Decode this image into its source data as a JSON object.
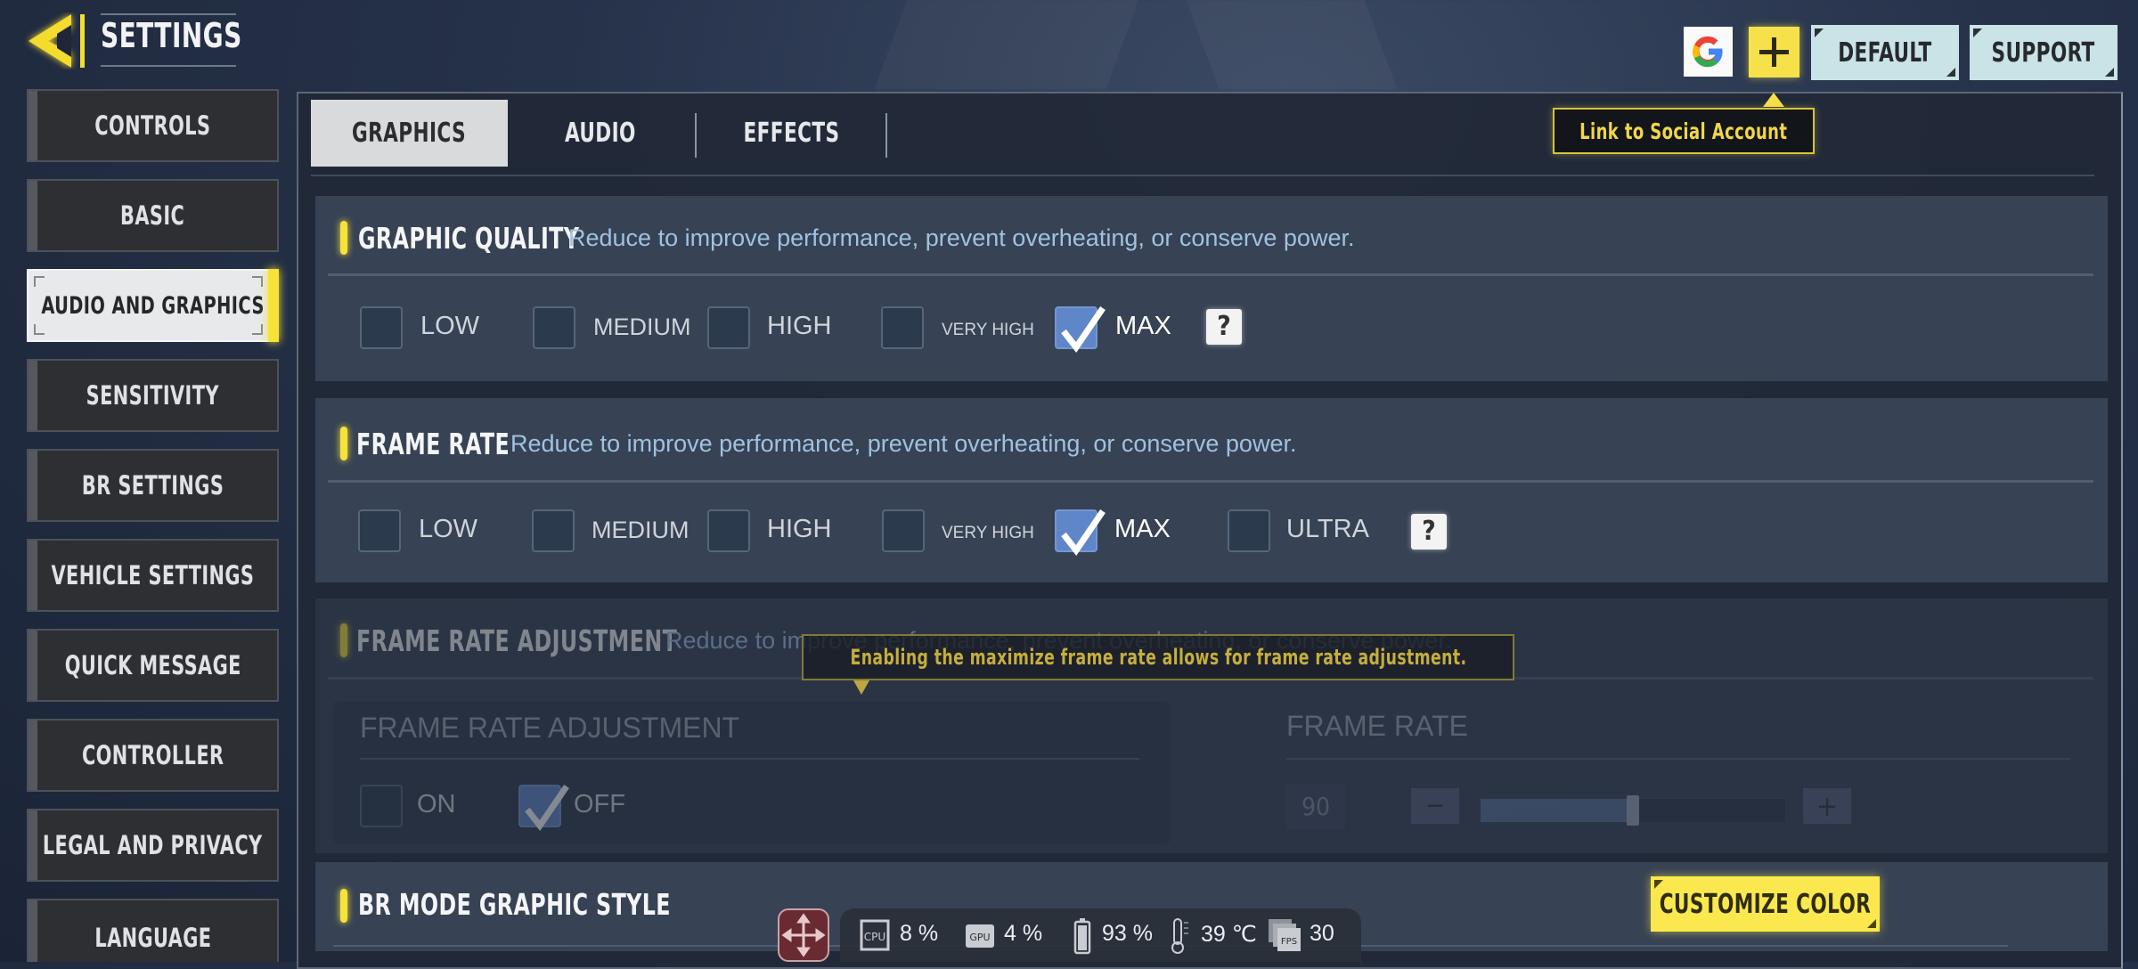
{
  "header": {
    "title": "SETTINGS",
    "back_icon": "back-arrow-icon"
  },
  "top_actions": {
    "google_icon": "google-icon",
    "link_icon": "plus-icon",
    "default_label": "DEFAULT",
    "support_label": "SUPPORT",
    "tooltip": "Link to Social Account"
  },
  "sidebar": {
    "items": [
      {
        "label": "CONTROLS",
        "active": false
      },
      {
        "label": "BASIC",
        "active": false
      },
      {
        "label": "AUDIO AND GRAPHICS",
        "active": true
      },
      {
        "label": "SENSITIVITY",
        "active": false
      },
      {
        "label": "BR SETTINGS",
        "active": false
      },
      {
        "label": "VEHICLE SETTINGS",
        "active": false
      },
      {
        "label": "QUICK MESSAGE",
        "active": false
      },
      {
        "label": "CONTROLLER",
        "active": false
      },
      {
        "label": "LEGAL AND PRIVACY",
        "active": false
      },
      {
        "label": "LANGUAGE",
        "active": false
      }
    ]
  },
  "tabs": [
    {
      "label": "GRAPHICS",
      "active": true
    },
    {
      "label": "AUDIO",
      "active": false
    },
    {
      "label": "EFFECTS",
      "active": false
    }
  ],
  "graphic_quality": {
    "title": "GRAPHIC QUALITY",
    "description": "Reduce to improve performance, prevent overheating, or conserve power.",
    "options": [
      {
        "label": "LOW",
        "checked": false
      },
      {
        "label": "MEDIUM",
        "checked": false
      },
      {
        "label": "HIGH",
        "checked": false
      },
      {
        "label": "VERY HIGH",
        "checked": false
      },
      {
        "label": "MAX",
        "checked": true
      }
    ],
    "help_label": "?"
  },
  "frame_rate": {
    "title": "FRAME RATE",
    "description": "Reduce to improve performance, prevent overheating, or conserve power.",
    "options": [
      {
        "label": "LOW",
        "checked": false
      },
      {
        "label": "MEDIUM",
        "checked": false
      },
      {
        "label": "HIGH",
        "checked": false
      },
      {
        "label": "VERY HIGH",
        "checked": false
      },
      {
        "label": "MAX",
        "checked": true
      },
      {
        "label": "ULTRA",
        "checked": false
      }
    ],
    "help_label": "?"
  },
  "frame_rate_adjustment": {
    "title": "FRAME RATE ADJUSTMENT",
    "description": "Reduce to improve performance, prevent overheating, or conserve power.",
    "tooltip": "Enabling the maximize frame rate allows for frame rate adjustment.",
    "disabled": true,
    "toggle_panel": {
      "title": "FRAME RATE ADJUSTMENT",
      "options": [
        {
          "label": "ON",
          "checked": false
        },
        {
          "label": "OFF",
          "checked": true
        }
      ]
    },
    "rate_panel": {
      "title": "FRAME RATE",
      "value": "90",
      "minus_label": "−",
      "plus_label": "+",
      "slider_fraction": 0.5
    }
  },
  "br_mode": {
    "title": "BR MODE GRAPHIC STYLE",
    "customize_label": "CUSTOMIZE COLOR"
  },
  "stats_overlay": {
    "move_icon": "move-icon",
    "cpu": "8 %",
    "gpu": "4 %",
    "battery": "93 %",
    "temperature": "39 ℃",
    "fps": "30"
  },
  "colors": {
    "accent_yellow": "#f6e33a",
    "checkbox_checked": "#5f86c8",
    "description_blue": "#9fc2df",
    "button_teal": "#c9e3e6"
  }
}
